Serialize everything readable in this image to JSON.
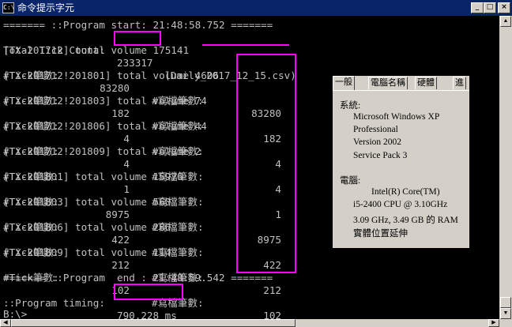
{
  "window": {
    "title": "命令提示字元",
    "app_icon": "C:\\",
    "buttons": {
      "minimize": "_",
      "maximize": "□",
      "close": "×"
    }
  },
  "console": {
    "header": "======= ::Program start: 21:48:58.752 =======",
    "tick_label": "Total Tick Count:",
    "tick_count": "233317",
    "tick_file": "(Daily_2017_12_15.csv)",
    "blocks": [
      {
        "header": "[TX-201712] total volume 175141",
        "tick_label": "#Tick筆數:",
        "tick": "83280",
        "write_label": "#寫檔筆數:",
        "write": "83280"
      },
      {
        "header": "[TX-201712!201801] total volume 4606",
        "tick_label": "#Tick筆數:",
        "tick": "182",
        "write_label": "#寫檔筆數:",
        "write": "182"
      },
      {
        "header": "[TX-201712!201803] total volume 74",
        "tick_label": "#Tick筆數:",
        "tick": "4",
        "write_label": "#寫檔筆數:",
        "write": "4"
      },
      {
        "header": "[TX-201712!201806] total volume 44",
        "tick_label": "#Tick筆數:",
        "tick": "4",
        "write_label": "#寫檔筆數:",
        "write": "4"
      },
      {
        "header": "[TX-201712!201809] total volume 2",
        "tick_label": "#Tick筆數:",
        "tick": "1",
        "write_label": "#寫檔筆數:",
        "write": "1"
      },
      {
        "header": "[TX-201801] total volume 15976",
        "tick_label": "#Tick筆數:",
        "tick": "8975",
        "write_label": "#寫檔筆數:",
        "write": "8975"
      },
      {
        "header": "[TX-201803] total volume 568",
        "tick_label": "#Tick筆數:",
        "tick": "422",
        "write_label": "#寫檔筆數:",
        "write": "422"
      },
      {
        "header": "[TX-201806] total volume 286",
        "tick_label": "#Tick筆數:",
        "tick": "212",
        "write_label": "#寫檔筆數:",
        "write": "212"
      },
      {
        "header": "[TX-201809] total volume 114",
        "tick_label": "#Tick筆數:",
        "tick": "102",
        "write_label": "#寫檔筆數:",
        "write": "102"
      }
    ],
    "footer": "======= ::Program  end : 21:48:59.542 =======",
    "timing_label": "::Program timing:",
    "timing_value": "790.228 ms",
    "prompt": "B:\\>_"
  },
  "sysinfo": {
    "tabs": [
      "一般",
      "電腦名稱",
      "硬體",
      "進"
    ],
    "system_label": "系統:",
    "os_name": "Microsoft Windows XP",
    "os_edition": "Professional",
    "os_version": "Version 2002",
    "service_pack": "Service Pack 3",
    "computer_label": "電腦:",
    "cpu_brand": "Intel(R) Core(TM)",
    "cpu_model": "i5-2400 CPU @ 3.10GHz",
    "cpu_speed_ram": "3.09 GHz, 3.49 GB 的 RAM",
    "pae": "實體位置延伸"
  },
  "colors": {
    "titlebar": "#0a246a",
    "console_bg": "#000000",
    "console_text": "#c0c0c0",
    "highlight": "#ff00ff",
    "chrome": "#d4d0c8"
  }
}
